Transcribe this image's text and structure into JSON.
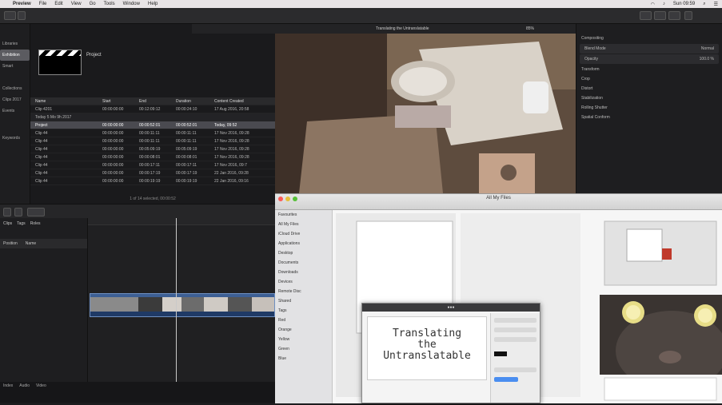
{
  "menubar": {
    "app": "Preview",
    "items": [
      "File",
      "Edit",
      "View",
      "Go",
      "Tools",
      "Window",
      "Help"
    ],
    "clock": "Sun 09:59"
  },
  "viewer": {
    "title": "Translating the Untranslatable",
    "zoom": "85%"
  },
  "browser": {
    "event_name": "Project",
    "table_headers": [
      "Name",
      "Start",
      "End",
      "Duration",
      "Content Created"
    ],
    "footer": "1 of 14 selected, 00:00:52",
    "rows": [
      {
        "type": "item",
        "name": "Clip 4201",
        "start": "00:00:00:00",
        "end": "00:12:09:12",
        "dur": "00:00:24:10",
        "created": "17 Aug 2016, 20:58"
      },
      {
        "type": "group",
        "name": "Today 5 Mo 9h 2017",
        "start": "",
        "end": "",
        "dur": "",
        "created": ""
      },
      {
        "type": "sel",
        "name": "Project",
        "start": "00:00:00:00",
        "end": "00:00:52:01",
        "dur": "00:00:52:01",
        "created": "Today, 09:52"
      },
      {
        "type": "item",
        "name": "Clip 44",
        "start": "00:00:00:00",
        "end": "00:00:11:11",
        "dur": "00:00:11:11",
        "created": "17 Nov 2016, 09:28"
      },
      {
        "type": "item",
        "name": "Clip 44",
        "start": "00:00:00:00",
        "end": "00:00:11:11",
        "dur": "00:00:11:11",
        "created": "17 Nov 2016, 09:28"
      },
      {
        "type": "item",
        "name": "Clip 44",
        "start": "00:00:00:00",
        "end": "00:05:09:19",
        "dur": "00:05:09:19",
        "created": "17 Nov 2016, 09:28"
      },
      {
        "type": "item",
        "name": "Clip 44",
        "start": "00:00:00:00",
        "end": "00:00:08:01",
        "dur": "00:00:08:01",
        "created": "17 Nov 2016, 09:28"
      },
      {
        "type": "item",
        "name": "Clip 44",
        "start": "00:00:00:00",
        "end": "00:00:17:11",
        "dur": "00:00:17:11",
        "created": "17 Nov 2016, 09:7"
      },
      {
        "type": "item",
        "name": "Clip 44",
        "start": "00:00:00:00",
        "end": "00:00:17:19",
        "dur": "00:00:17:19",
        "created": "22 Jan 2016, 09:28"
      },
      {
        "type": "item",
        "name": "Clip 44",
        "start": "00:00:00:00",
        "end": "00:00:19:19",
        "dur": "00:00:19:19",
        "created": "22 Jan 2016, 09:16"
      }
    ]
  },
  "library_sidebar": {
    "items": [
      "Libraries",
      "Exhibition",
      "Smart",
      "Collections",
      "Clips 2017",
      "Events",
      "Keywords"
    ]
  },
  "inspector": {
    "rows": [
      {
        "label": "Compositing",
        "value": ""
      },
      {
        "label": "Blend Mode",
        "value": "Normal"
      },
      {
        "label": "Opacity",
        "value": "100.0 %"
      },
      {
        "label": "Transform",
        "value": ""
      },
      {
        "label": "Crop",
        "value": ""
      },
      {
        "label": "Distort",
        "value": ""
      },
      {
        "label": "Stabilization",
        "value": ""
      },
      {
        "label": "Rolling Shutter",
        "value": ""
      },
      {
        "label": "Spatial Conform",
        "value": ""
      }
    ]
  },
  "timeline": {
    "index_tabs": [
      "Clips",
      "Tags",
      "Roles"
    ],
    "index_col_headers": [
      "Position",
      "Name"
    ],
    "bottom_tabs": [
      "Index",
      "Audio",
      "Video"
    ]
  },
  "finder": {
    "title": "All My Files",
    "sidebar": [
      "Favourites",
      "All My Files",
      "iCloud Drive",
      "Applications",
      "Desktop",
      "Documents",
      "Downloads",
      "Devices",
      "Remote Disc",
      "Shared",
      "Tags",
      "Red",
      "Orange",
      "Yellow",
      "Green",
      "Blue"
    ]
  },
  "document": {
    "line1": "Translating",
    "line2": "the",
    "line3": "Untranslatable"
  },
  "colors": {
    "app_bg": "#1c1c1e",
    "timeline_clip": "#2a4b7d",
    "selection": "#4a4a50"
  }
}
